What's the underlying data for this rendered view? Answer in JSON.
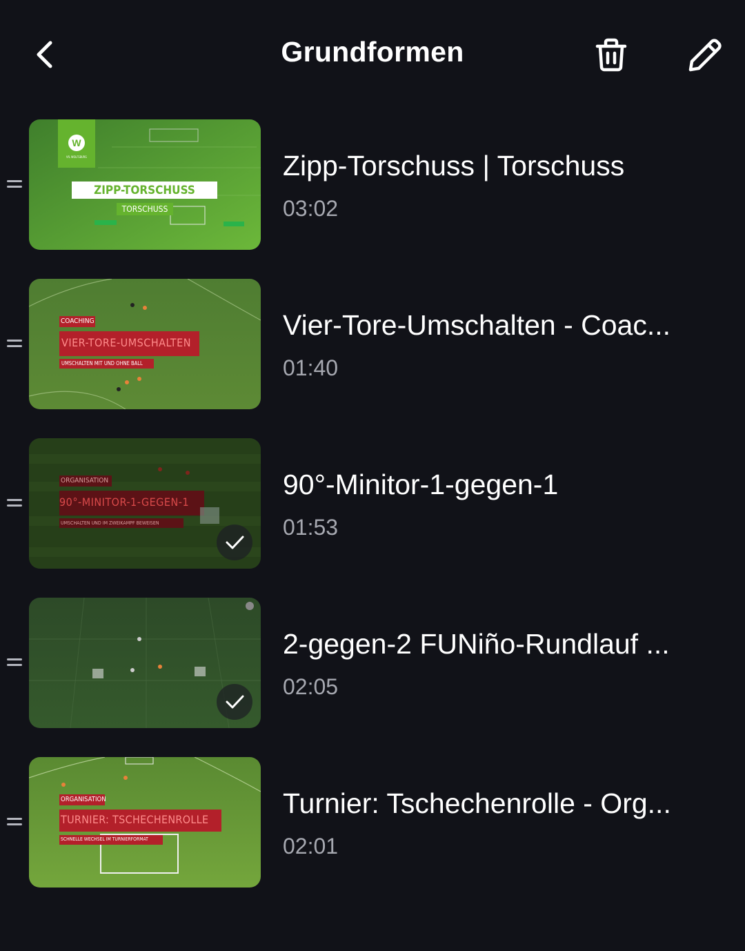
{
  "header": {
    "title": "Grundformen",
    "back_icon": "chevron-left-icon",
    "delete_icon": "trash-icon",
    "edit_icon": "pencil-icon"
  },
  "colors": {
    "background": "#111218",
    "text": "#ffffff",
    "secondary_text": "#a6a8b0",
    "field_green": "#5a9a2e",
    "overlay_red": "#b3202a",
    "wolfsburg_green": "#65b32e"
  },
  "videos": [
    {
      "title": "Zipp-Torschuss | Torschuss",
      "duration": "03:02",
      "watched": false,
      "thumbnail": {
        "badge_small": "VfL WOLFSBURG",
        "label": "ZIPP-TORSCHUSS",
        "sublabel": "TORSCHUSS"
      }
    },
    {
      "title": "Vier-Tore-Umschalten - Coac...",
      "duration": "01:40",
      "watched": false,
      "thumbnail": {
        "category": "COACHING",
        "label": "VIER-TORE-UMSCHALTEN",
        "sublabel": "UMSCHALTEN MIT UND OHNE BALL"
      }
    },
    {
      "title": "90°-Minitor-1-gegen-1",
      "duration": "01:53",
      "watched": true,
      "thumbnail": {
        "category": "ORGANISATION",
        "label": "90°-MINITOR-1-GEGEN-1",
        "sublabel": "UMSCHALTEN UND IM ZWEIKAMPF BEWEISEN"
      }
    },
    {
      "title": "2-gegen-2 FUNiño-Rundlauf ...",
      "duration": "02:05",
      "watched": true,
      "thumbnail": {}
    },
    {
      "title": "Turnier: Tschechenrolle - Org...",
      "duration": "02:01",
      "watched": false,
      "thumbnail": {
        "category": "ORGANISATION",
        "label": "TURNIER: TSCHECHENROLLE",
        "sublabel": "SCHNELLE WECHSEL IM TURNIERFORMAT"
      }
    }
  ]
}
